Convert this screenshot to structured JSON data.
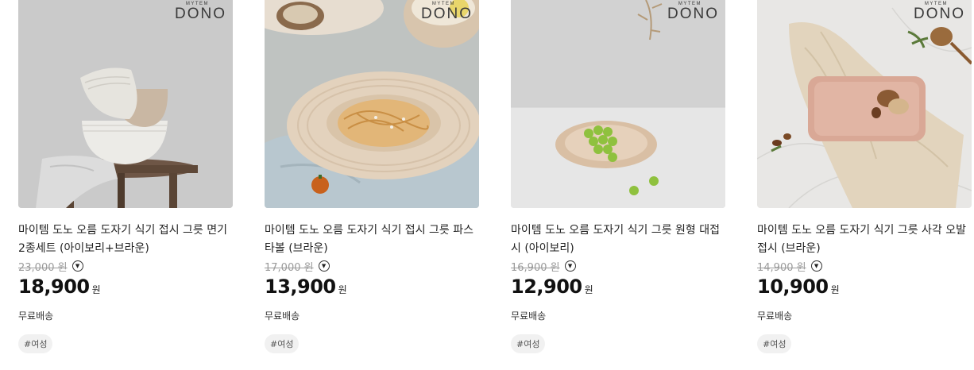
{
  "products": [
    {
      "title": "마이템 도노 오름 도자기 식기 접시 그릇 면기 2종세트 (아이보리+브라운)",
      "original_price": "23,000 원",
      "sale_price": "18,900",
      "currency_unit": "원",
      "shipping": "무료배송",
      "tag": "#여성",
      "brand_sub": "MYTEM",
      "brand": "DONO"
    },
    {
      "title": "마이템 도노 오름 도자기 식기 접시 그릇 파스타볼 (브라운)",
      "original_price": "17,000 원",
      "sale_price": "13,900",
      "currency_unit": "원",
      "shipping": "무료배송",
      "tag": "#여성",
      "brand_sub": "MYTEM",
      "brand": "DONO"
    },
    {
      "title": "마이템 도노 오름 도자기 식기 그릇 원형 대접시 (아이보리)",
      "original_price": "16,900 원",
      "sale_price": "12,900",
      "currency_unit": "원",
      "shipping": "무료배송",
      "tag": "#여성",
      "brand_sub": "MYTEM",
      "brand": "DONO"
    },
    {
      "title": "마이템 도노 오름 도자기 식기 그릇 사각 오발접시 (브라운)",
      "original_price": "14,900 원",
      "sale_price": "10,900",
      "currency_unit": "원",
      "shipping": "무료배송",
      "tag": "#여성",
      "brand_sub": "MYTEM",
      "brand": "DONO"
    }
  ]
}
